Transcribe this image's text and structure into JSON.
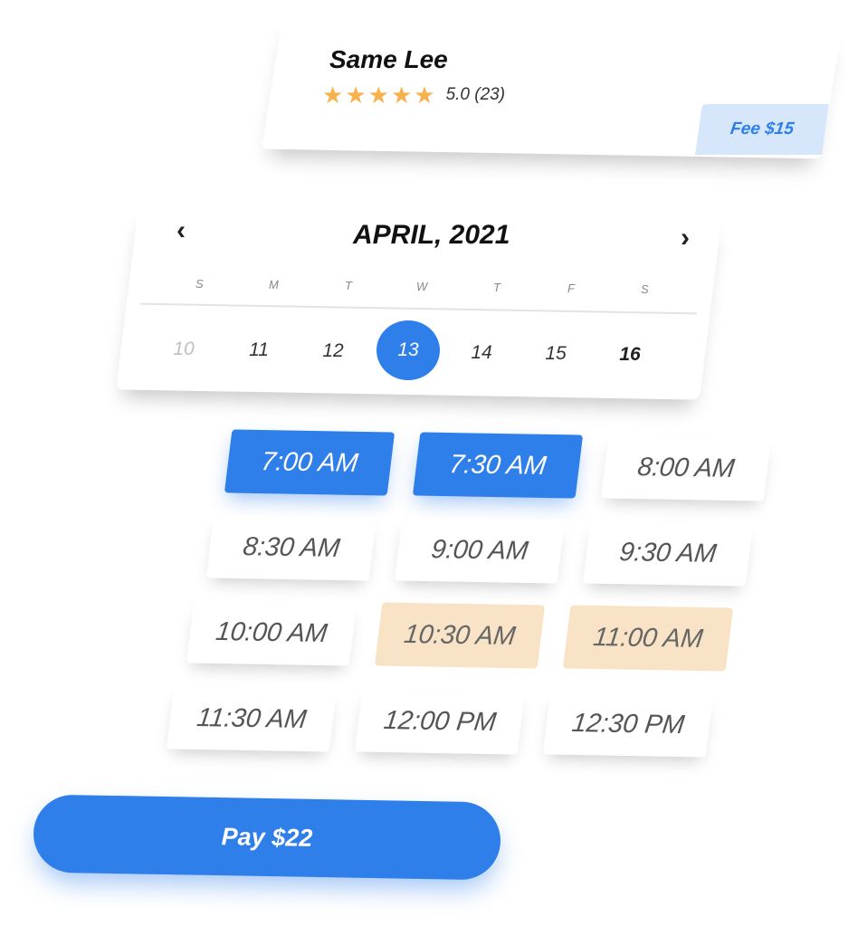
{
  "profile": {
    "name": "Same Lee",
    "rating_stars": 5,
    "rating_text": "5.0 (23)",
    "fee_label": "Fee $15"
  },
  "calendar": {
    "month_title": "APRIL, 2021",
    "prev_icon": "chevron-left-icon",
    "next_icon": "chevron-right-icon",
    "weekdays": [
      "S",
      "M",
      "T",
      "W",
      "T",
      "F",
      "S"
    ],
    "days": [
      "10",
      "11",
      "12",
      "13",
      "14",
      "15",
      "16"
    ],
    "selected_day": "13"
  },
  "time_slots": [
    {
      "label": "7:00 AM",
      "state": "selected"
    },
    {
      "label": "7:30 AM",
      "state": "selected"
    },
    {
      "label": "8:00 AM",
      "state": "available"
    },
    {
      "label": "8:30 AM",
      "state": "available"
    },
    {
      "label": "9:00 AM",
      "state": "available"
    },
    {
      "label": "9:30 AM",
      "state": "available"
    },
    {
      "label": "10:00 AM",
      "state": "available"
    },
    {
      "label": "10:30 AM",
      "state": "unavailable"
    },
    {
      "label": "11:00 AM",
      "state": "unavailable"
    },
    {
      "label": "11:30 AM",
      "state": "available"
    },
    {
      "label": "12:00 PM",
      "state": "available"
    },
    {
      "label": "12:30 PM",
      "state": "available"
    }
  ],
  "pay_button": {
    "label": "Pay $22"
  },
  "colors": {
    "accent": "#2f7fea",
    "star": "#f7b24d",
    "unavailable": "#f9e3c6",
    "fee_badge_bg": "#d6e6fb"
  }
}
